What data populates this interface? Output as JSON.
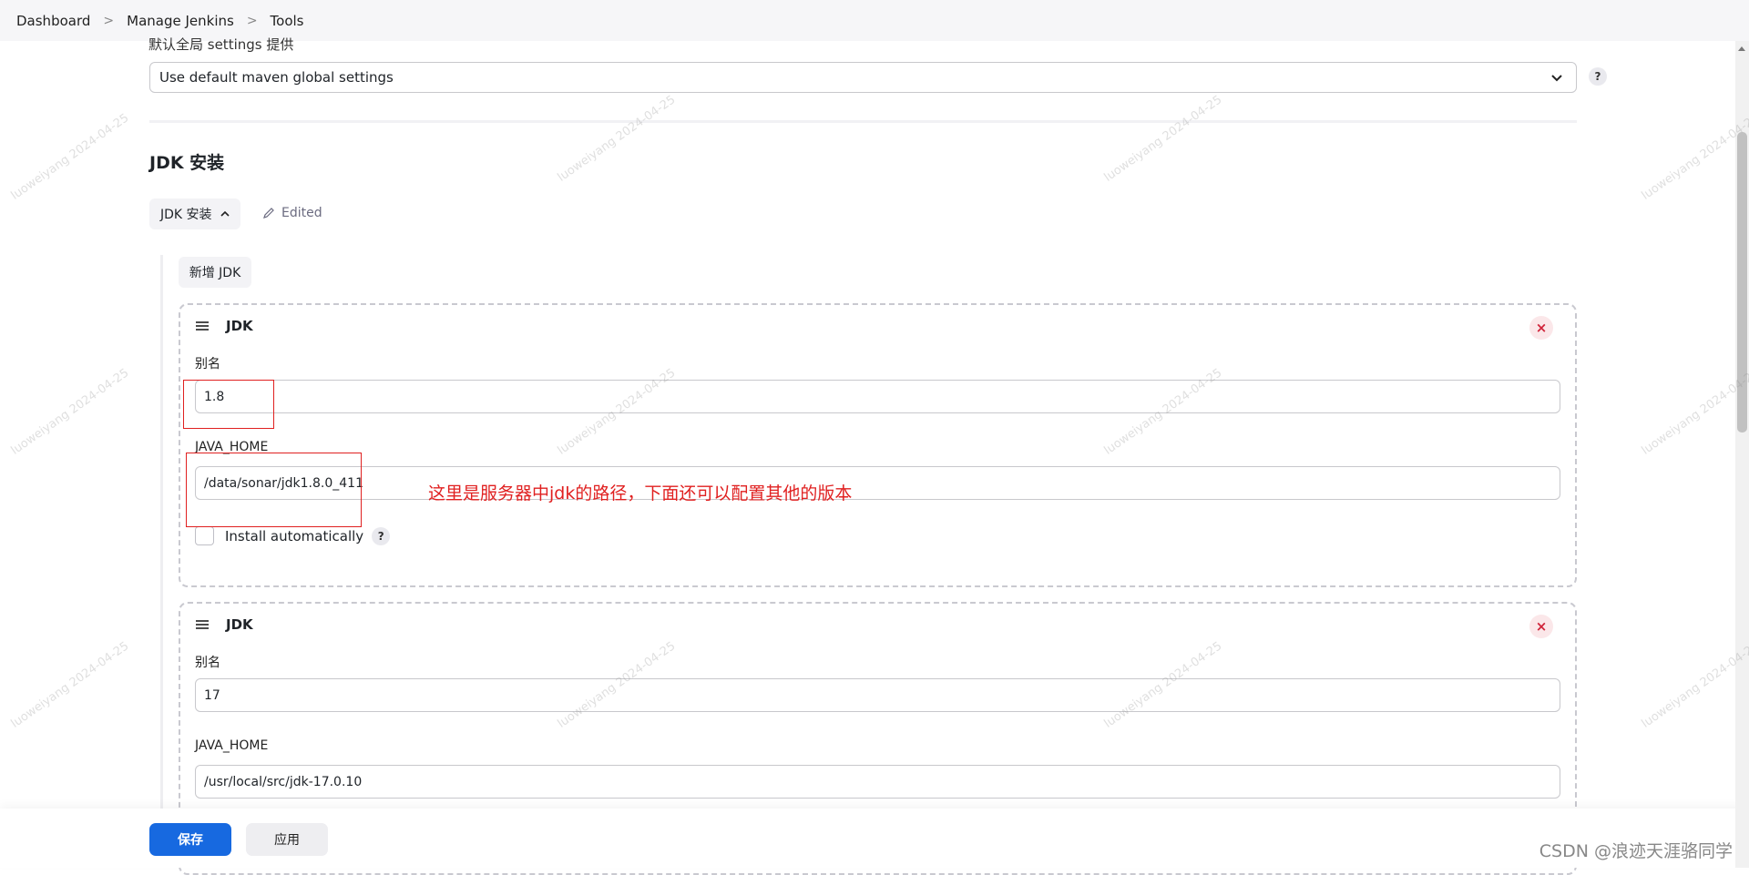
{
  "breadcrumb": {
    "items": [
      "Dashboard",
      "Manage Jenkins",
      "Tools"
    ]
  },
  "maven": {
    "settings_label": "默认全局 settings 提供",
    "selected_option": "Use default maven global settings"
  },
  "jdk_section": {
    "title": "JDK 安装",
    "toggle_label": "JDK 安装",
    "edited_label": "Edited",
    "add_button": "新增 JDK",
    "installations": [
      {
        "title": "JDK",
        "alias_label": "别名",
        "alias_value": "1.8",
        "home_label": "JAVA_HOME",
        "home_value": "/data/sonar/jdk1.8.0_411",
        "install_label": "Install automatically"
      },
      {
        "title": "JDK",
        "alias_label": "别名",
        "alias_value": "17",
        "home_label": "JAVA_HOME",
        "home_value": "/usr/local/src/jdk-17.0.10"
      }
    ]
  },
  "annotation": "这里是服务器中jdk的路径，下面还可以配置其他的版本",
  "footer": {
    "save": "保存",
    "apply": "应用"
  },
  "csdn_mark": "CSDN @浪迹天涯骆同学",
  "watermark": "luoweiyang 2024-04-25",
  "help_glyph": "?",
  "close_glyph": "×",
  "colors": {
    "primary": "#1769e0",
    "annotation_red": "#e02020"
  }
}
